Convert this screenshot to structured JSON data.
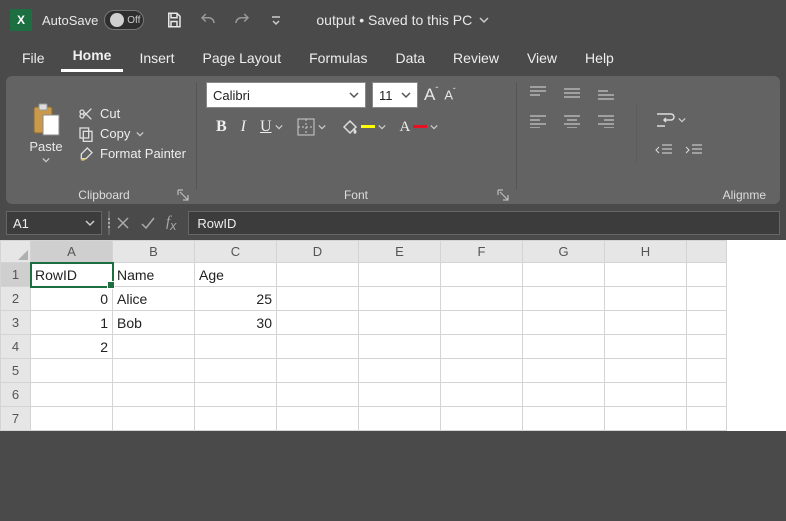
{
  "titlebar": {
    "autosave_label": "AutoSave",
    "toggle_state": "Off",
    "doc_title": "output • Saved to this PC"
  },
  "tabs": [
    "File",
    "Home",
    "Insert",
    "Page Layout",
    "Formulas",
    "Data",
    "Review",
    "View",
    "Help"
  ],
  "active_tab_index": 1,
  "ribbon": {
    "clipboard": {
      "paste": "Paste",
      "cut": "Cut",
      "copy": "Copy",
      "format_painter": "Format Painter",
      "group_title": "Clipboard"
    },
    "font": {
      "font_name": "Calibri",
      "font_size": "11",
      "group_title": "Font"
    },
    "alignment": {
      "group_title": "Alignme"
    }
  },
  "formula_bar": {
    "name_box": "A1",
    "formula_value": "RowID"
  },
  "grid": {
    "columns": [
      "A",
      "B",
      "C",
      "D",
      "E",
      "F",
      "G",
      "H"
    ],
    "row_numbers": [
      1,
      2,
      3,
      4,
      5,
      6,
      7
    ],
    "selected_cell": "A1",
    "data": [
      {
        "A": {
          "v": "RowID",
          "t": "txt"
        },
        "B": {
          "v": "Name",
          "t": "txt"
        },
        "C": {
          "v": "Age",
          "t": "txt"
        }
      },
      {
        "A": {
          "v": "0",
          "t": "num"
        },
        "B": {
          "v": "Alice",
          "t": "txt"
        },
        "C": {
          "v": "25",
          "t": "num"
        }
      },
      {
        "A": {
          "v": "1",
          "t": "num"
        },
        "B": {
          "v": "Bob",
          "t": "txt"
        },
        "C": {
          "v": "30",
          "t": "num"
        }
      },
      {
        "A": {
          "v": "2",
          "t": "num"
        }
      },
      {},
      {},
      {}
    ]
  },
  "chart_data": {
    "type": "table",
    "columns": [
      "RowID",
      "Name",
      "Age"
    ],
    "rows": [
      [
        0,
        "Alice",
        25
      ],
      [
        1,
        "Bob",
        30
      ],
      [
        2,
        null,
        null
      ]
    ]
  }
}
